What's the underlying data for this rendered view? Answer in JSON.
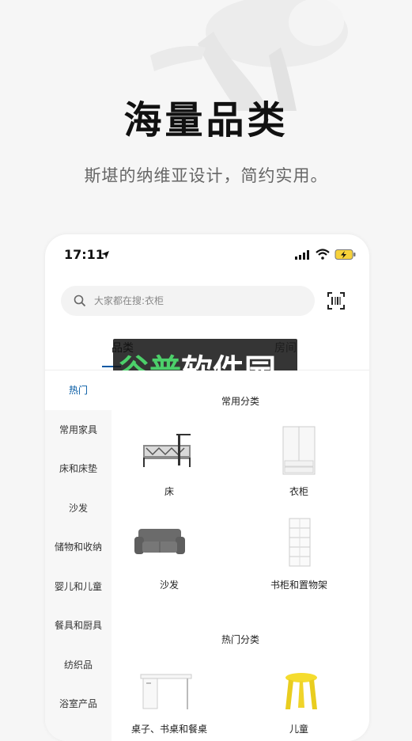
{
  "hero": {
    "title": "海量品类",
    "subtitle": "斯堪的纳维亚设计，简约实用。"
  },
  "status_bar": {
    "time": "17:11"
  },
  "search": {
    "placeholder": "大家都在搜:衣柜"
  },
  "tabs": [
    {
      "label": "品类"
    },
    {
      "label": "房间"
    }
  ],
  "watermark": {
    "part1": "谷普",
    "part2": "软件园"
  },
  "sidebar": {
    "items": [
      {
        "label": "热门",
        "active": true
      },
      {
        "label": "常用家具"
      },
      {
        "label": "床和床垫"
      },
      {
        "label": "沙发"
      },
      {
        "label": "储物和收纳"
      },
      {
        "label": "婴儿和儿童"
      },
      {
        "label": "餐具和厨具"
      },
      {
        "label": "纺织品"
      },
      {
        "label": "浴室产品"
      }
    ]
  },
  "sections": {
    "common": {
      "title": "常用分类",
      "items": [
        {
          "label": "床"
        },
        {
          "label": "衣柜"
        },
        {
          "label": "沙发"
        },
        {
          "label": "书柜和置物架"
        }
      ]
    },
    "hot": {
      "title": "热门分类",
      "items": [
        {
          "label": "桌子、书桌和餐桌"
        },
        {
          "label": "儿童"
        }
      ]
    }
  },
  "colors": {
    "accent": "#0058a3",
    "watermark_green": "#4cd06a",
    "stool_yellow": "#f5dc2e"
  }
}
